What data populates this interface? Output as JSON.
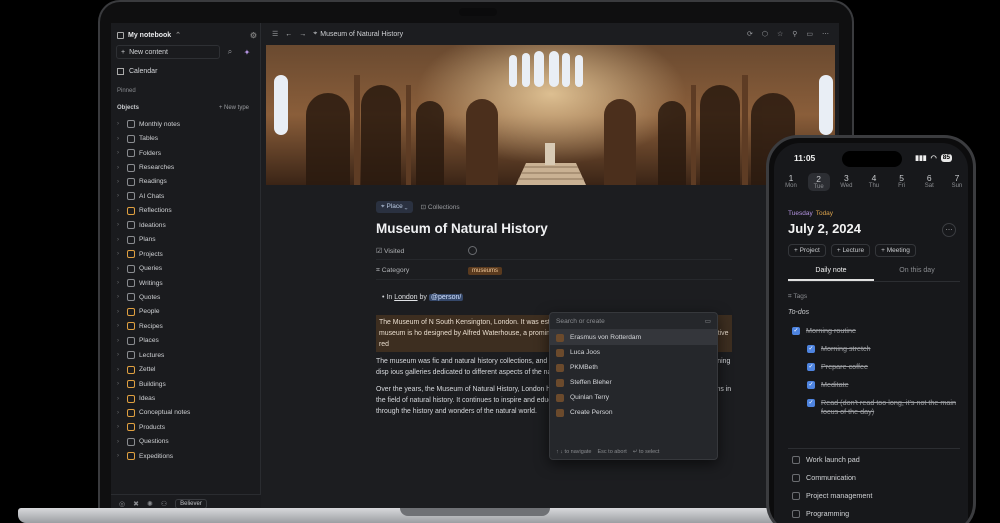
{
  "sidebar": {
    "notebook": "My notebook",
    "new_content": "New content",
    "calendar": "Calendar",
    "pinned": "Pinned",
    "objects": "Objects",
    "new_type": "+ New type",
    "items": [
      {
        "label": "Monthly notes",
        "color": "#8a8c90"
      },
      {
        "label": "Tables",
        "color": "#8a8c90"
      },
      {
        "label": "Folders",
        "color": "#8a8c90"
      },
      {
        "label": "Researches",
        "color": "#8a8c90"
      },
      {
        "label": "Readings",
        "color": "#8a8c90"
      },
      {
        "label": "AI Chats",
        "color": "#8a8c90"
      },
      {
        "label": "Reflections",
        "color": "#e0a040"
      },
      {
        "label": "Ideations",
        "color": "#8a8c90"
      },
      {
        "label": "Plans",
        "color": "#8a8c90"
      },
      {
        "label": "Projects",
        "color": "#e0a040"
      },
      {
        "label": "Queries",
        "color": "#8a8c90"
      },
      {
        "label": "Writings",
        "color": "#8a8c90"
      },
      {
        "label": "Quotes",
        "color": "#8a8c90"
      },
      {
        "label": "People",
        "color": "#e0a040"
      },
      {
        "label": "Recipes",
        "color": "#e0a040"
      },
      {
        "label": "Places",
        "color": "#8a8c90"
      },
      {
        "label": "Lectures",
        "color": "#8a8c90"
      },
      {
        "label": "Zettel",
        "color": "#e0a040"
      },
      {
        "label": "Buildings",
        "color": "#e0a040"
      },
      {
        "label": "Ideas",
        "color": "#e0a040"
      },
      {
        "label": "Conceptual notes",
        "color": "#e0a040"
      },
      {
        "label": "Products",
        "color": "#e0a040"
      },
      {
        "label": "Questions",
        "color": "#8a8c90"
      },
      {
        "label": "Expeditions",
        "color": "#e0a040"
      }
    ],
    "footer_badge": "Believer"
  },
  "topbar": {
    "crumb": "Museum of Natural History"
  },
  "doc": {
    "place_chip": "Place",
    "collections": "Collections",
    "title": "Museum of Natural History",
    "prop_visited": "Visited",
    "prop_category": "Category",
    "category_tag": "museums",
    "bullet_in": "In",
    "bullet_link": "London",
    "bullet_by": "by",
    "bullet_mention": "@person/",
    "para1": "The Museum of N                                        South Kensington, London. It was established in 188                                        history specimens and artifacts. The museum is ho                                        designed by Alfred Waterhouse, a prominent English                                        nesque Revival, characterized by its distinctive red",
    "para2": "The museum was                                        fic and natural history collections, and its purpose re                                        work of art, with intricate details and stunning disp                                        ious galleries dedicated to different aspects of the nat                                        plants, animals, and human evolution.",
    "para3": "Over the years, the Museum of Natural History, London has grown to become one of the world's leading museums in the field of natural history. It continues to inspire and educate visitors of all ages, providing a fascinating journey through the history and wonders of the natural world."
  },
  "popup": {
    "search": "Search or create",
    "items": [
      "Erasmus von Rotterdam",
      "Luca Joos",
      "PKMBeth",
      "Steffen Bleher",
      "Quinlan Terry",
      "Create Person"
    ],
    "hint1": "↑ ↓ to navigate",
    "hint2": "Esc to abort",
    "hint3": "↵ to select"
  },
  "phone": {
    "time": "11:05",
    "battery": "85",
    "week": [
      {
        "n": "1",
        "w": "Mon"
      },
      {
        "n": "2",
        "w": "Tue"
      },
      {
        "n": "3",
        "w": "Wed"
      },
      {
        "n": "4",
        "w": "Thu"
      },
      {
        "n": "5",
        "w": "Fri"
      },
      {
        "n": "6",
        "w": "Sat"
      },
      {
        "n": "7",
        "w": "Sun"
      }
    ],
    "day_name": "Tuesday",
    "today": "Today",
    "date": "July 2, 2024",
    "chips": [
      "+ Project",
      "+ Lecture",
      "+ Meeting"
    ],
    "tab1": "Daily note",
    "tab2": "On this day",
    "tags": "Tags",
    "todos": "To-dos",
    "todo_items": [
      "Morning routine",
      "Morning stretch",
      "Prepare coffee",
      "Meditate",
      "Read (don't read too long, it's not the main focus of the day)",
      "Work launch pad",
      "Communication",
      "Project management",
      "Programming"
    ]
  }
}
